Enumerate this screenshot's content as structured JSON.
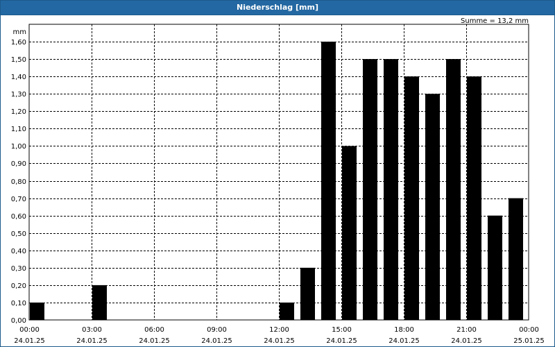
{
  "window": {
    "title": "Niederschlag [mm]"
  },
  "chart_data": {
    "type": "bar",
    "title": "Niederschlag [mm]",
    "ylabel": "mm",
    "annotation": "Summe = 13,2 mm",
    "ylim": [
      0,
      1.7
    ],
    "yticks": [
      "0,00",
      "0,10",
      "0,20",
      "0,30",
      "0,40",
      "0,50",
      "0,60",
      "0,70",
      "0,80",
      "0,90",
      "1,00",
      "1,10",
      "1,20",
      "1,30",
      "1,40",
      "1,50",
      "1,60"
    ],
    "xticks": [
      {
        "time": "00:00",
        "date": "24.01.25"
      },
      {
        "time": "03:00",
        "date": "24.01.25"
      },
      {
        "time": "06:00",
        "date": "24.01.25"
      },
      {
        "time": "09:00",
        "date": "24.01.25"
      },
      {
        "time": "12:00",
        "date": "24.01.25"
      },
      {
        "time": "15:00",
        "date": "24.01.25"
      },
      {
        "time": "18:00",
        "date": "24.01.25"
      },
      {
        "time": "21:00",
        "date": "24.01.25"
      },
      {
        "time": "00:00",
        "date": "25.01.25"
      }
    ],
    "categories": [
      "00:00",
      "01:00",
      "02:00",
      "03:00",
      "04:00",
      "05:00",
      "06:00",
      "07:00",
      "08:00",
      "09:00",
      "10:00",
      "11:00",
      "12:00",
      "13:00",
      "14:00",
      "15:00",
      "16:00",
      "17:00",
      "18:00",
      "19:00",
      "20:00",
      "21:00",
      "22:00",
      "23:00"
    ],
    "values": [
      0.1,
      0,
      0,
      0.2,
      0,
      0,
      0,
      0,
      0,
      0,
      0,
      0,
      0.1,
      0.3,
      1.6,
      1.0,
      1.5,
      1.5,
      1.4,
      1.3,
      1.5,
      1.4,
      0.6,
      0.7
    ],
    "bar_color": "#000000",
    "grid": true
  }
}
